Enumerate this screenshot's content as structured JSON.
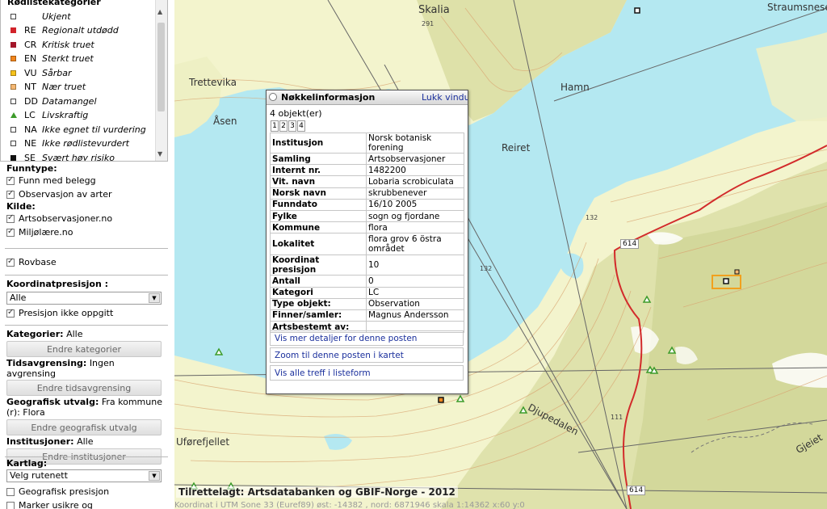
{
  "legend": {
    "title": "Rødlistekategorier",
    "items": [
      {
        "code": "",
        "name": "Ukjent",
        "color": "#ffffff",
        "shape": "square"
      },
      {
        "code": "RE",
        "name": "Regionalt utdødd",
        "color": "#d2232a",
        "shape": "square"
      },
      {
        "code": "CR",
        "name": "Kritisk truet",
        "color": "#a3162a",
        "shape": "square"
      },
      {
        "code": "EN",
        "name": "Sterkt truet",
        "color": "#f1861e",
        "shape": "square"
      },
      {
        "code": "VU",
        "name": "Sårbar",
        "color": "#f6c21a",
        "shape": "square"
      },
      {
        "code": "NT",
        "name": "Nær truet",
        "color": "#f5b874",
        "shape": "square"
      },
      {
        "code": "DD",
        "name": "Datamangel",
        "color": "#ffffff",
        "shape": "square"
      },
      {
        "code": "LC",
        "name": "Livskraftig",
        "color": "#3c9b2a",
        "shape": "triangle"
      },
      {
        "code": "NA",
        "name": "Ikke egnet til vurdering",
        "color": "#ffffff",
        "shape": "square"
      },
      {
        "code": "NE",
        "name": "Ikke rødlistevurdert",
        "color": "#ffffff",
        "shape": "square"
      },
      {
        "code": "SE",
        "name": "Svært høy risiko",
        "color": "#111111",
        "shape": "square"
      }
    ]
  },
  "filters": {
    "funntype_label": "Funntype:",
    "funntype": [
      {
        "label": "Funn med belegg",
        "checked": true
      },
      {
        "label": "Observasjon av arter",
        "checked": true
      }
    ],
    "kilde_label": "Kilde:",
    "kilde": [
      {
        "label": "Artsobservasjoner.no",
        "checked": true
      },
      {
        "label": "Miljølære.no",
        "checked": true
      }
    ],
    "rovbase": {
      "label": "Rovbase",
      "checked": true
    },
    "koordinat_label": "Koordinatpresisjon :",
    "koordinat_value": "Alle",
    "presisjon_ikke": {
      "label": "Presisjon ikke oppgitt",
      "checked": true
    },
    "kategorier_label": "Kategorier:",
    "kategorier_value": "Alle",
    "endre_kategorier": "Endre kategorier",
    "tidsavgrensing_label": "Tidsavgrensing:",
    "tidsavgrensing_value": "Ingen avgrensing",
    "endre_tidsavgrensing": "Endre tidsavgrensing",
    "geografisk_label": "Geografisk utvalg:",
    "geografisk_value": "Fra kommune",
    "geografisk_value2": "(r): Flora",
    "endre_geografisk": "Endre geografisk utvalg",
    "institusjoner_label": "Institusjoner:",
    "institusjoner_value": "Alle",
    "endre_institusjoner": "Endre institusjoner",
    "kartlag_label": "Kartlag:",
    "kartlag_value": "Velg rutenett",
    "geo_presisjon": {
      "label": "Geografisk presisjon",
      "checked": false
    },
    "marker_usikre": {
      "label": "Marker usikre og",
      "checked": false
    }
  },
  "map": {
    "places": {
      "skalia": "Skalia",
      "straumsnes": "Straumsnese",
      "trettevika": "Trettevika",
      "hamn": "Hamn",
      "asen": "Åsen",
      "reiret": "Reiret",
      "djupedalen": "Djupedalen",
      "uforefjellet": "Uførefjellet",
      "gjeiet": "Gjeiet"
    },
    "elevations": {
      "e291": "291",
      "e132a": "132",
      "e132b": "132",
      "e111": "111"
    },
    "roads": {
      "r614a": "614",
      "r614b": "614"
    },
    "attribution": "Tilrettelagt: Artsdatabanken og GBIF-Norge - 2012",
    "coords_text": "Koordinat i UTM Sone 33 (Euref89) øst: -14382 , nord: 6871946   skala 1:14362   x:60   y:0"
  },
  "popup": {
    "title": "Nøkkelinformasjon",
    "close": "Lukk vindu",
    "count": "4 objekt(er)",
    "pages": [
      "1",
      "2",
      "3",
      "4"
    ],
    "rows": [
      {
        "key": "Institusjon",
        "value": "Norsk botanisk forening"
      },
      {
        "key": "Samling",
        "value": "Artsobservasjoner"
      },
      {
        "key": "Internt nr.",
        "value": "1482200"
      },
      {
        "key": "Vit. navn",
        "value": "Lobaria scrobiculata"
      },
      {
        "key": "Norsk navn",
        "value": "skrubbenever"
      },
      {
        "key": "Funndato",
        "value": "16/10 2005"
      },
      {
        "key": "Fylke",
        "value": "sogn og fjordane"
      },
      {
        "key": "Kommune",
        "value": "flora"
      },
      {
        "key": "Lokalitet",
        "value": "flora grov 6 östra området"
      },
      {
        "key": "Koordinat presisjon",
        "value": "10"
      },
      {
        "key": "Antall",
        "value": "0"
      },
      {
        "key": "Kategori",
        "value": "LC"
      },
      {
        "key": "Type objekt:",
        "value": "Observation"
      },
      {
        "key": "Finner/samler:",
        "value": "Magnus Andersson"
      },
      {
        "key": "Artsbestemt av:",
        "value": ""
      }
    ],
    "links": {
      "details": "Vis mer detaljer for denne posten",
      "zoom": "Zoom til denne posten i kartet",
      "list": "Vis alle treff i listeform"
    }
  }
}
